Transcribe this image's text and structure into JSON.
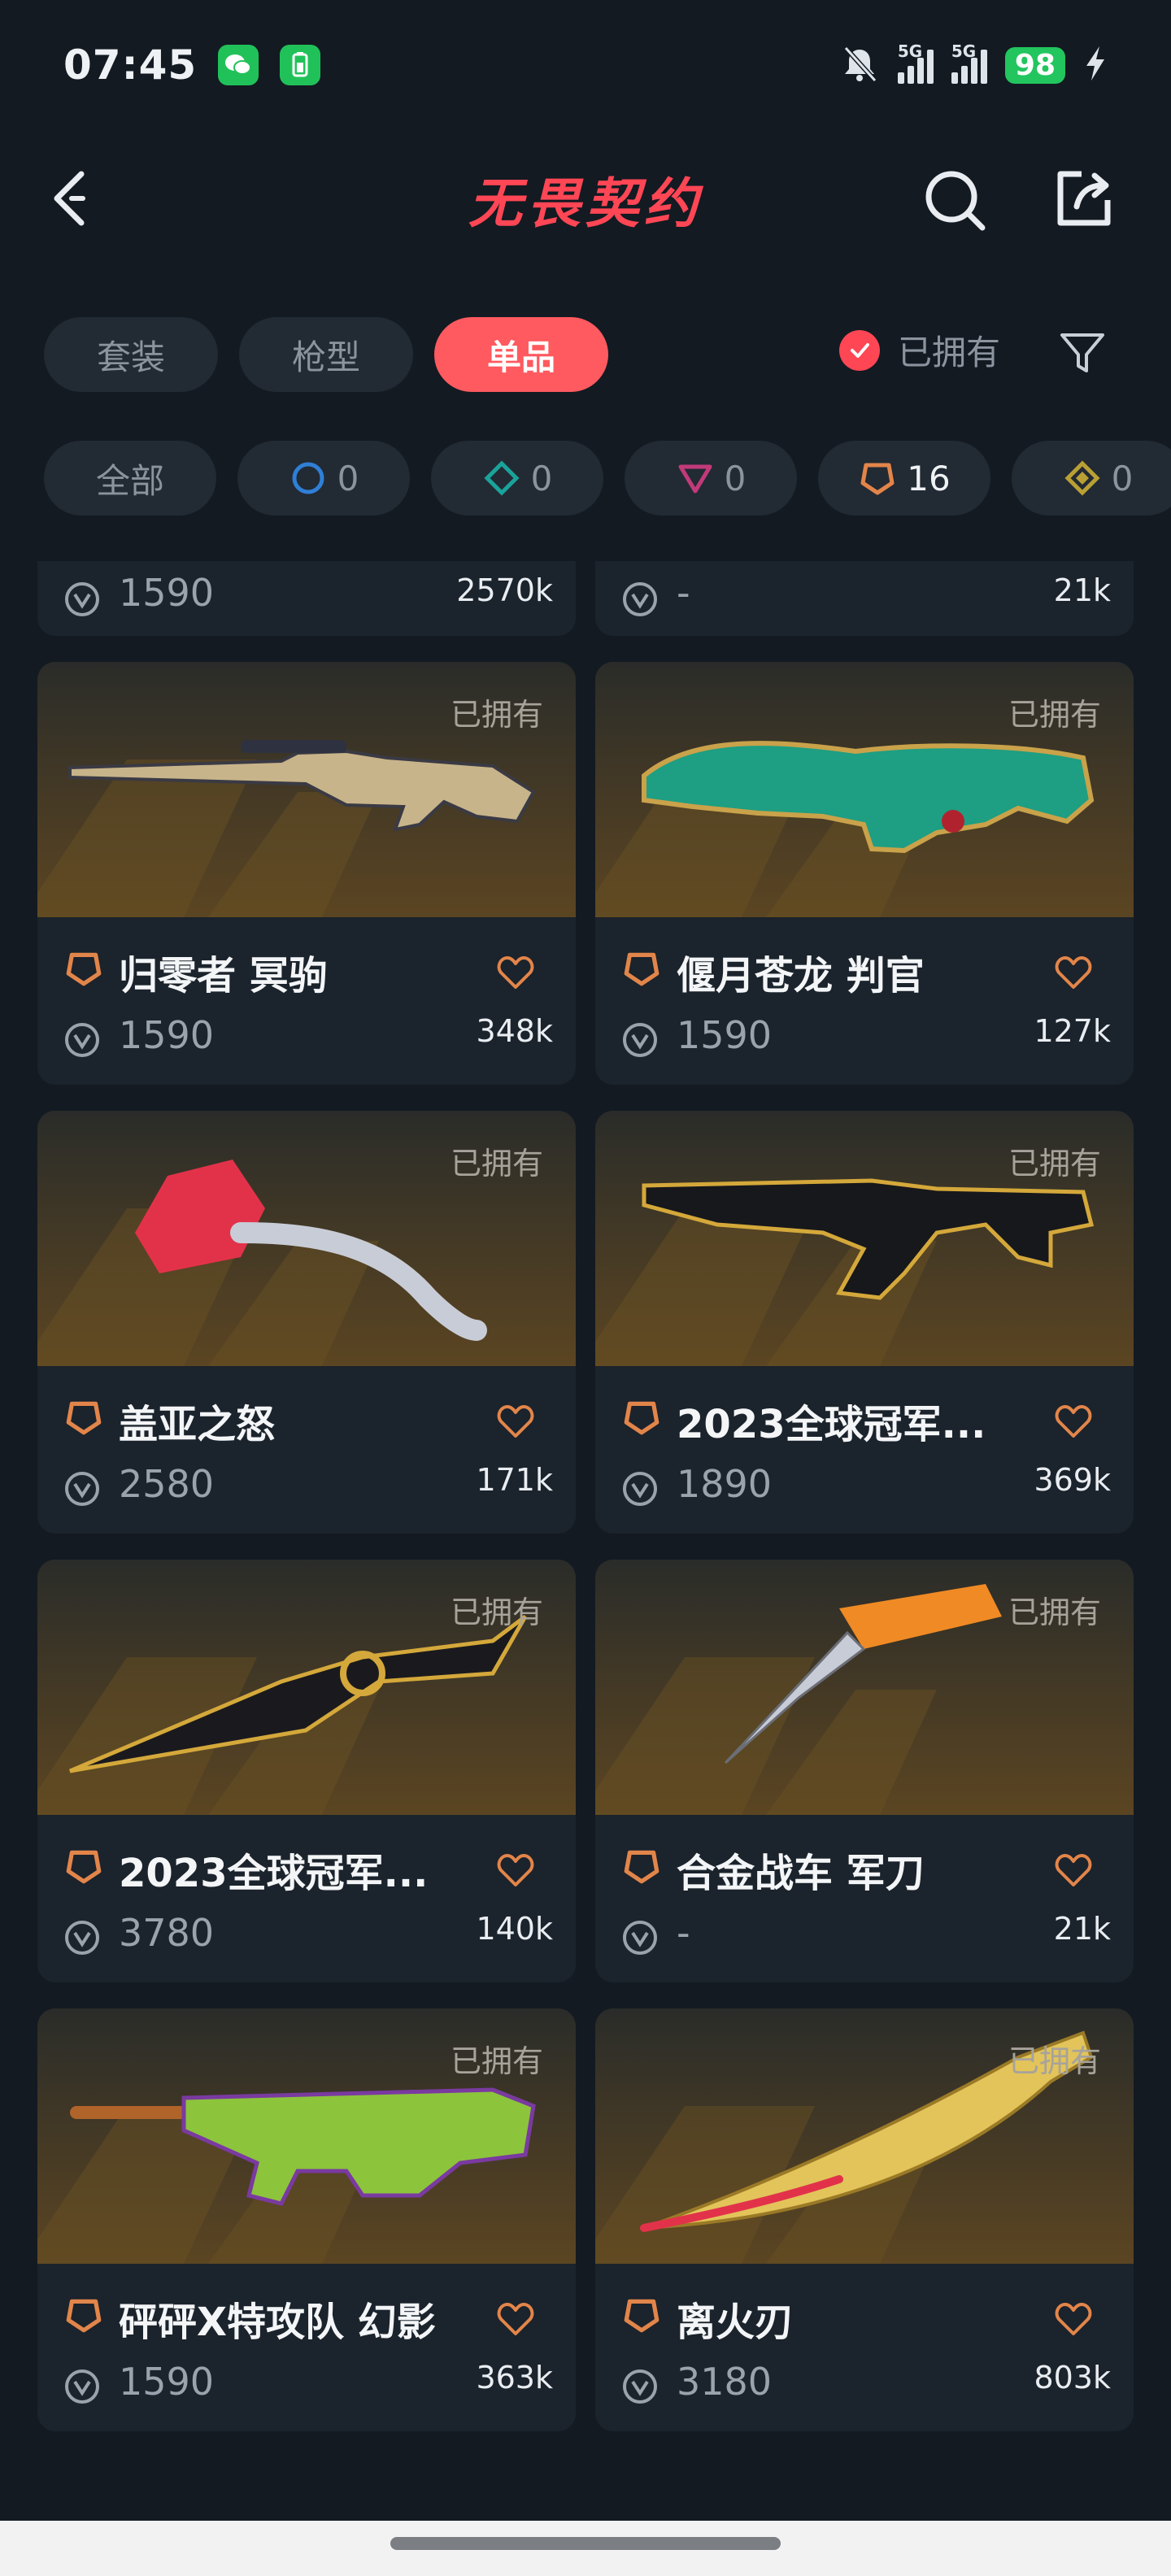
{
  "status_bar": {
    "time": "07:45",
    "net1": "5G",
    "net2": "5G",
    "battery": "98"
  },
  "header": {
    "title": "无畏契约",
    "back_icon": "back-arrow-icon",
    "search_icon": "search-icon",
    "share_icon": "share-icon"
  },
  "tabs": [
    {
      "label": "套装",
      "active": false
    },
    {
      "label": "枪型",
      "active": false
    },
    {
      "label": "单品",
      "active": true
    }
  ],
  "owned_filter": {
    "label": "已拥有",
    "checked": true
  },
  "tier_chips": [
    {
      "label": "全部",
      "count": null
    },
    {
      "label": "",
      "count": "0",
      "icon": "select-tier-icon",
      "color": "#2f7fd6"
    },
    {
      "label": "",
      "count": "0",
      "icon": "deluxe-tier-icon",
      "color": "#1aa39a"
    },
    {
      "label": "",
      "count": "0",
      "icon": "premium-tier-icon",
      "color": "#c23a7a"
    },
    {
      "label": "",
      "count": "16",
      "icon": "exclusive-tier-icon",
      "color": "#e2854a"
    },
    {
      "label": "",
      "count": "0",
      "icon": "ultra-tier-icon",
      "color": "#b8a034"
    }
  ],
  "partial_row": [
    {
      "price": "1590",
      "likes": "2570k"
    },
    {
      "price": "-",
      "likes": "21k"
    }
  ],
  "items": [
    {
      "name": "归零者 冥驹",
      "price": "1590",
      "likes": "348k",
      "owned": "已拥有",
      "weapon": "sniper"
    },
    {
      "name": "偃月苍龙 判官",
      "price": "1590",
      "likes": "127k",
      "owned": "已拥有",
      "weapon": "shotgun"
    },
    {
      "name": "盖亚之怒",
      "price": "2580",
      "likes": "171k",
      "owned": "已拥有",
      "weapon": "axe"
    },
    {
      "name": "2023全球冠军...",
      "price": "1890",
      "likes": "369k",
      "owned": "已拥有",
      "weapon": "rifle"
    },
    {
      "name": "2023全球冠军...",
      "price": "3780",
      "likes": "140k",
      "owned": "已拥有",
      "weapon": "kunai"
    },
    {
      "name": "合金战车 军刀",
      "price": "-",
      "likes": "21k",
      "owned": "已拥有",
      "weapon": "knife"
    },
    {
      "name": "砰砰X特攻队 幻影",
      "price": "1590",
      "likes": "363k",
      "owned": "已拥有",
      "weapon": "toyrifle"
    },
    {
      "name": "离火刃",
      "price": "3180",
      "likes": "803k",
      "owned": "已拥有",
      "weapon": "blade"
    }
  ],
  "colors": {
    "accent": "#ff4655",
    "active_tab": "#ff5a5f",
    "tier_exclusive": "#e2854a",
    "background": "#131a22",
    "card": "#1b232c"
  }
}
